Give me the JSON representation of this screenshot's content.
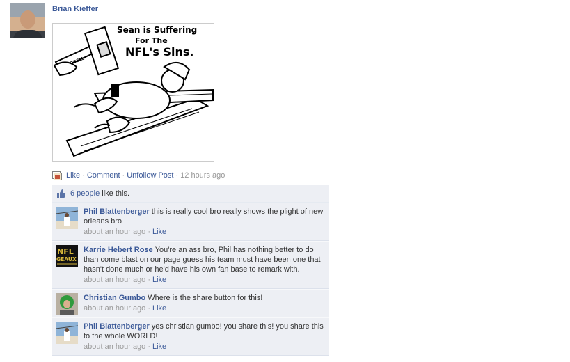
{
  "post": {
    "author_name": "Brian Kieffer",
    "image_caption_line1": "Sean is Suffering",
    "image_caption_line2": "For The",
    "image_caption_line3": "NFL's Sins.",
    "image_hammer_label": "GOODELL",
    "actions": {
      "like": "Like",
      "comment": "Comment",
      "unfollow": "Unfollow Post"
    },
    "separator": "·",
    "timestamp": "12 hours ago"
  },
  "likes": {
    "count_text": "6 people",
    "suffix": " like this."
  },
  "comments": [
    {
      "author": "Phil Blattenberger",
      "text": "this is really cool bro really shows the plight of new orleans bro",
      "time": "about an hour ago",
      "like": "Like",
      "avatar": "beach-photo"
    },
    {
      "author": "Karrie Hebert Rose",
      "text": "You're an ass bro, Phil has nothing better to do than come blast on our page guess his team must have been one that hasn't done much or he'd have his own fan base to remark with.",
      "time": "about an hour ago",
      "like": "Like",
      "avatar": "nfl-geaux-logo",
      "avatar_text_line1": "NFL",
      "avatar_text_line2": "GEAUX"
    },
    {
      "author": "Christian Gumbo",
      "text": "Where is the share button for this!",
      "time": "about an hour ago",
      "like": "Like",
      "avatar": "green-wig-photo"
    },
    {
      "author": "Phil Blattenberger",
      "text": "yes christian gumbo! you share this! you share this to the whole WORLD!",
      "time": "about an hour ago",
      "like": "Like",
      "avatar": "beach-photo"
    }
  ],
  "colors": {
    "link": "#3b5998",
    "muted": "#999999",
    "panel": "#edeff4"
  }
}
